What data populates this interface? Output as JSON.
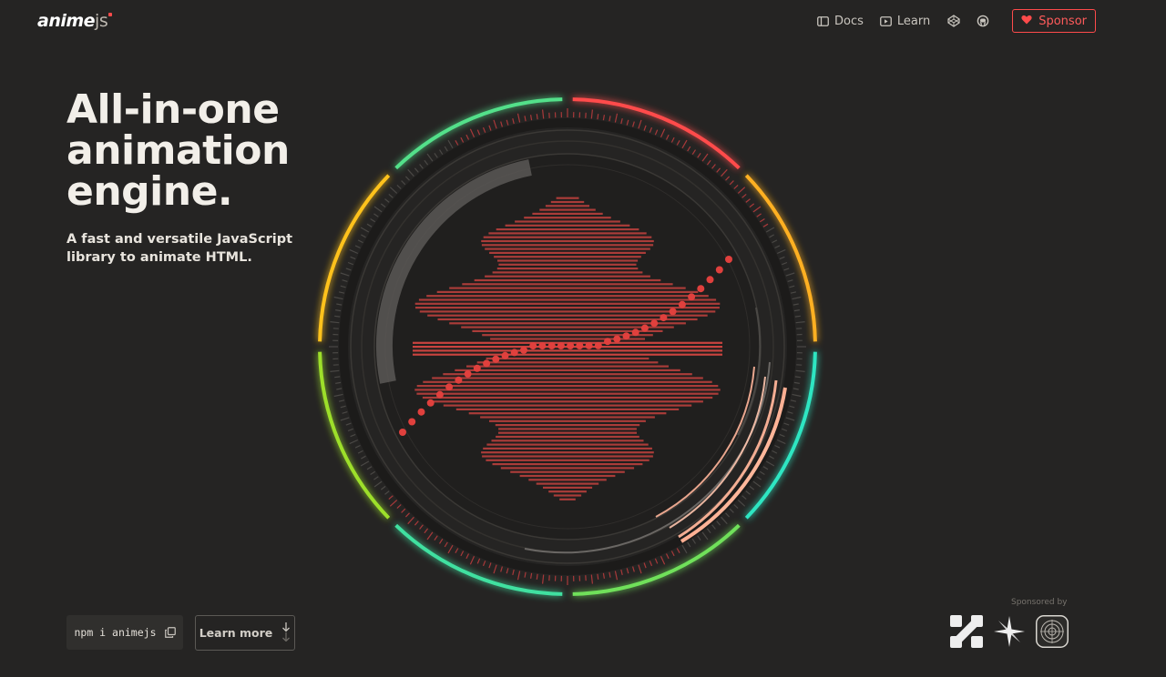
{
  "brand": {
    "logo_main": "anime",
    "logo_suffix": "js"
  },
  "nav": {
    "docs_label": "Docs",
    "learn_label": "Learn",
    "sponsor_label": "Sponsor"
  },
  "hero": {
    "title_line1": "All-in-one",
    "title_line2": "animation",
    "title_line3": "engine.",
    "subtitle": "A fast and versatile JavaScript library to animate HTML."
  },
  "install": {
    "command": "npm i animejs"
  },
  "cta": {
    "learn_more_label": "Learn more"
  },
  "sponsors": {
    "label": "Sponsored by"
  },
  "colors": {
    "background": "#252423",
    "accent": "#ff4b4b",
    "ring_segments": [
      "#ff4b4b",
      "#ffb020",
      "#2ee6c2",
      "#6fe05a",
      "#3fe0a0",
      "#9ddf2a",
      "#ffc21a",
      "#52e08a"
    ]
  },
  "icons": [
    "docs-icon",
    "play-icon",
    "codepen-icon",
    "github-icon",
    "heart-icon",
    "copy-icon",
    "arrow-down-icon"
  ]
}
